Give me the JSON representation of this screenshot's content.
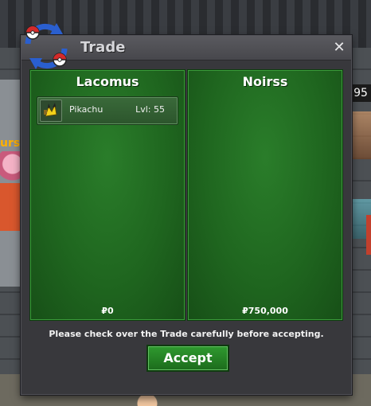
{
  "background": {
    "left_text": "urse",
    "right_number": "95"
  },
  "window": {
    "title": "Trade",
    "close_icon": "close-icon",
    "logo_icon": "trade-swap-icon"
  },
  "left_player": {
    "name": "Lacomus",
    "items": [
      {
        "icon": "pikachu-sprite-icon",
        "name": "Pikachu",
        "level": "Lvl: 55"
      }
    ],
    "money": "₽0"
  },
  "right_player": {
    "name": "Noirss",
    "items": [],
    "money": "₽750,000"
  },
  "notice": "Please check over the Trade carefully before accepting.",
  "accept_label": "Accept",
  "colors": {
    "panel_green": "#1f661f",
    "button_green": "#2f9a2f",
    "window_bg": "#38383c"
  }
}
